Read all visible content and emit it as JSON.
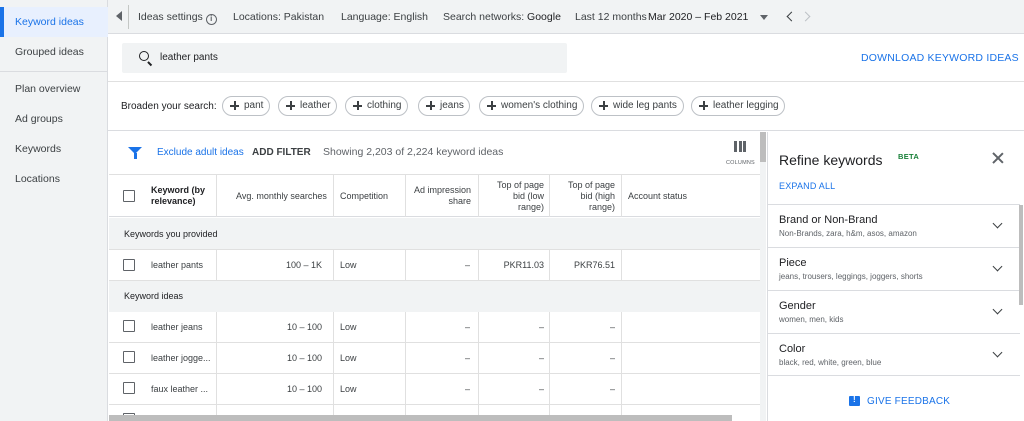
{
  "nav": {
    "items": [
      "Keyword ideas",
      "Grouped ideas",
      "Plan overview",
      "Ad groups",
      "Keywords",
      "Locations"
    ]
  },
  "topbar": {
    "ideas_settings": "Ideas settings",
    "locations": "Locations: Pakistan",
    "language": "Language: English",
    "networks_label": "Search networks:",
    "networks_value": "Google",
    "period_label": "Last 12 months",
    "period_value": "Mar 2020 – Feb 2021"
  },
  "search": {
    "value": "leather pants",
    "download": "DOWNLOAD KEYWORD IDEAS"
  },
  "broaden": {
    "label": "Broaden your search:",
    "chips": [
      "pant",
      "leather",
      "clothing",
      "jeans",
      "women's clothing",
      "wide leg pants",
      "leather legging"
    ]
  },
  "toolbar": {
    "exclude_adult": "Exclude adult ideas",
    "add_filter": "ADD FILTER",
    "showing": "Showing 2,203 of 2,224 keyword ideas",
    "columns": "COLUMNS"
  },
  "table": {
    "headers": {
      "keyword": [
        "Keyword (by",
        "relevance)"
      ],
      "searches": "Avg. monthly searches",
      "competition": "Competition",
      "impression": [
        "Ad impression",
        "share"
      ],
      "bid_low": [
        "Top of page",
        "bid (low",
        "range)"
      ],
      "bid_high": [
        "Top of page",
        "bid (high",
        "range)"
      ],
      "status": "Account status"
    },
    "section_provided": "Keywords you provided",
    "section_ideas": "Keyword ideas",
    "provided_rows": [
      {
        "keyword": "leather pants",
        "searches": "100 – 1K",
        "competition": "Low",
        "impression": "–",
        "bid_low": "PKR11.03",
        "bid_high": "PKR76.51"
      }
    ],
    "idea_rows": [
      {
        "keyword": "leather jeans",
        "searches": "10 – 100",
        "competition": "Low",
        "impression": "–",
        "bid_low": "–",
        "bid_high": "–"
      },
      {
        "keyword": "leather jogge...",
        "searches": "10 – 100",
        "competition": "Low",
        "impression": "–",
        "bid_low": "–",
        "bid_high": "–"
      },
      {
        "keyword": "faux leather ...",
        "searches": "10 – 100",
        "competition": "Low",
        "impression": "–",
        "bid_low": "–",
        "bid_high": "–"
      }
    ]
  },
  "refine": {
    "title": "Refine keywords",
    "beta": "BETA",
    "expand_all": "EXPAND ALL",
    "items": [
      {
        "title": "Brand or Non-Brand",
        "sub": "Non-Brands, zara, h&m, asos, amazon"
      },
      {
        "title": "Piece",
        "sub": "jeans, trousers, leggings, joggers, shorts"
      },
      {
        "title": "Gender",
        "sub": "women, men, kids"
      },
      {
        "title": "Color",
        "sub": "black, red, white, green, blue"
      }
    ],
    "feedback": "GIVE FEEDBACK"
  },
  "colors": {
    "accent": "#1a73e8",
    "beta": "#188038"
  }
}
